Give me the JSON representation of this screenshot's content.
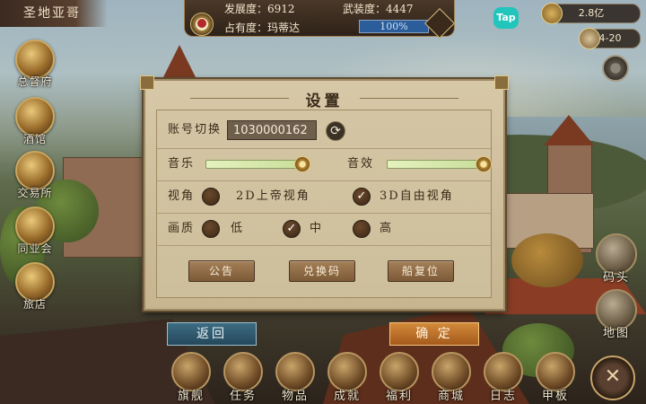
{
  "top": {
    "region": "圣地亚哥",
    "development": "发展度：6912",
    "military": "武装度：4447",
    "occupancy_label": "占有度：玛蒂达",
    "occupancy_percent": "100%",
    "occupancy_fraction": 1.0
  },
  "tap_badge": "Tap",
  "resources": {
    "gold": "2.8亿",
    "time": "4-20"
  },
  "left_menu": [
    {
      "label": "总督府",
      "icon": "crown-icon"
    },
    {
      "label": "酒馆",
      "icon": "beer-mug-icon"
    },
    {
      "label": "交易所",
      "icon": "scales-icon"
    },
    {
      "label": "同业会",
      "icon": "guild-shield-icon"
    },
    {
      "label": "旅店",
      "icon": "inn-icon"
    }
  ],
  "right_menu": [
    {
      "label": "码头",
      "icon": "dock-icon"
    },
    {
      "label": "地图",
      "icon": "map-scroll-icon"
    }
  ],
  "dialog": {
    "title": "设置",
    "account_label": "账号切换",
    "account_value": "1030000162",
    "music_label": "音乐",
    "music_level": 1.0,
    "sfx_label": "音效",
    "sfx_level": 1.0,
    "view_label": "视角",
    "view_options": [
      "2D上帝视角",
      "3D自由视角"
    ],
    "view_selected": "3D自由视角",
    "quality_label": "画质",
    "quality_options": [
      "低",
      "中",
      "高"
    ],
    "quality_selected": "中",
    "buttons": [
      "公告",
      "兑换码",
      "船复位"
    ]
  },
  "back_button": "返回",
  "confirm_button": "确 定",
  "bottom_nav": [
    {
      "label": "旗舰",
      "icon": "ship-wheel-icon"
    },
    {
      "label": "任务",
      "icon": "quest-scroll-icon"
    },
    {
      "label": "物品",
      "icon": "bag-icon"
    },
    {
      "label": "成就",
      "icon": "trophy-icon"
    },
    {
      "label": "福利",
      "icon": "gift-pouch-icon"
    },
    {
      "label": "商城",
      "icon": "treasure-chest-icon"
    },
    {
      "label": "日志",
      "icon": "journal-icon"
    },
    {
      "label": "甲板",
      "icon": "deck-ship-icon"
    }
  ],
  "close_icon": "close-crossed-swords-icon"
}
